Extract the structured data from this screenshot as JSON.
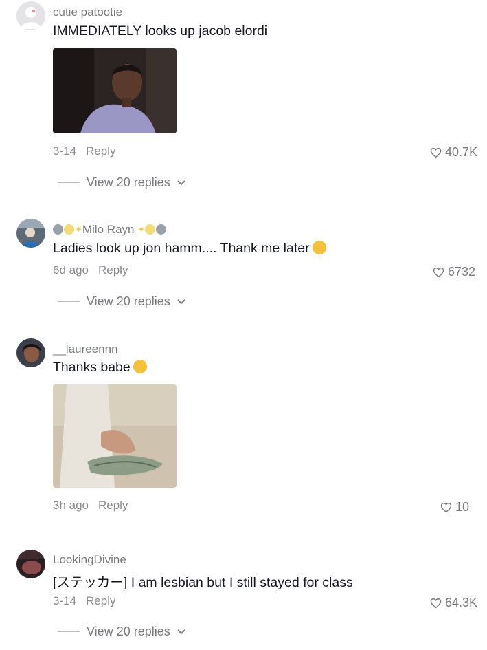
{
  "comments": [
    {
      "username": "cutie patootie",
      "text": "IMMEDIATELY looks up jacob elordi",
      "date": "3-14",
      "reply_label": "Reply",
      "likes": "40.7K",
      "view_replies": "View 20 replies"
    },
    {
      "username": "Milo Rayn",
      "text": "Ladies look up jon hamm.... Thank me later",
      "date": "6d ago",
      "reply_label": "Reply",
      "likes": "6732",
      "view_replies": "View 20 replies"
    },
    {
      "username": "__laureennn",
      "text": "Thanks babe",
      "date": "3h ago",
      "reply_label": "Reply",
      "likes": "10"
    },
    {
      "username": "LookingDivine",
      "text": "[ステッカー] I am lesbian but I still stayed for class",
      "date": "3-14",
      "reply_label": "Reply",
      "likes": "64.3K",
      "view_replies": "View 20 replies"
    }
  ],
  "colors": {
    "text": "#161823",
    "muted": "#8a8b91",
    "background": "#ffffff"
  }
}
